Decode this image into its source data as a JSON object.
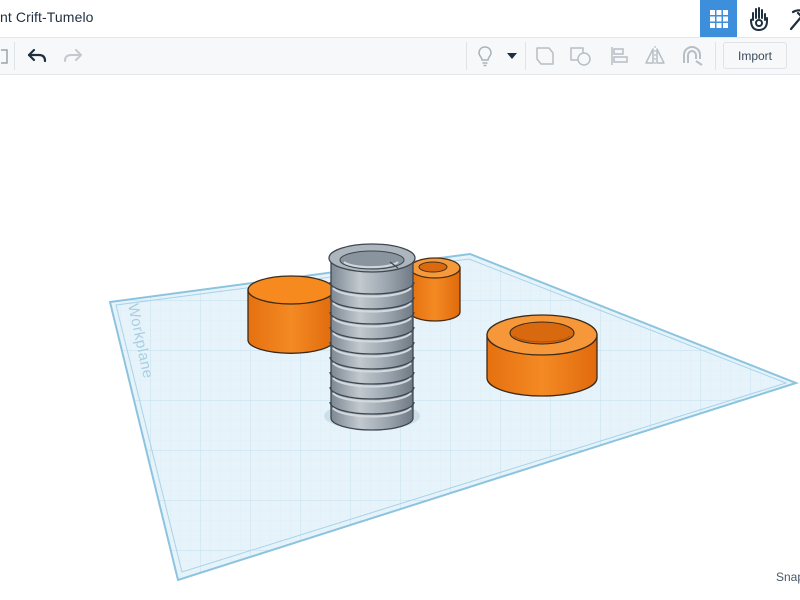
{
  "header": {
    "title": "nt Crift-Tumelo"
  },
  "toolbar": {
    "import_label": "Import"
  },
  "workplane": {
    "label": "Workplane"
  },
  "footer": {
    "snap_label": "Snap"
  },
  "colors": {
    "accent": "#3d8fdc",
    "grid": "#cfe6f2",
    "grid_border": "#8cc4e0",
    "orange": "#f07b14",
    "screw": "#9aa3ad"
  },
  "icons": {
    "view_grid": "grid-icon",
    "view_blocks": "blocks-hand-icon",
    "view_bricks": "pickaxe-icon"
  }
}
